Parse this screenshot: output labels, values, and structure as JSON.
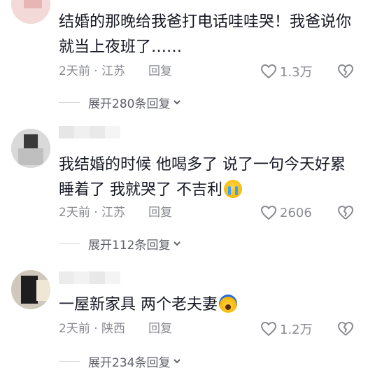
{
  "comments": [
    {
      "text": "结婚的那晚给我爸打电话哇哇哭！我爸说你就当上夜班了……",
      "emoji": "",
      "time_location": "2天前 · 江苏",
      "reply_label": "回复",
      "likes": "1.3万",
      "expand_label": "展开280条回复"
    },
    {
      "text": "我结婚的时候 他喝多了 说了一句今天好累睡着了 我就哭了 不吉利",
      "emoji": "crying-face-icon",
      "time_location": "2天前 · 江苏",
      "reply_label": "回复",
      "likes": "2606",
      "expand_label": "展开112条回复"
    },
    {
      "text": "一屋新家具 两个老夫妻",
      "emoji": "fearful-face-icon",
      "time_location": "2天前 · 陕西",
      "reply_label": "回复",
      "likes": "1.2万",
      "expand_label": "展开234条回复"
    }
  ],
  "colors": {
    "text": "#161823",
    "meta": "#8a8b91",
    "expand": "#5f6069"
  }
}
